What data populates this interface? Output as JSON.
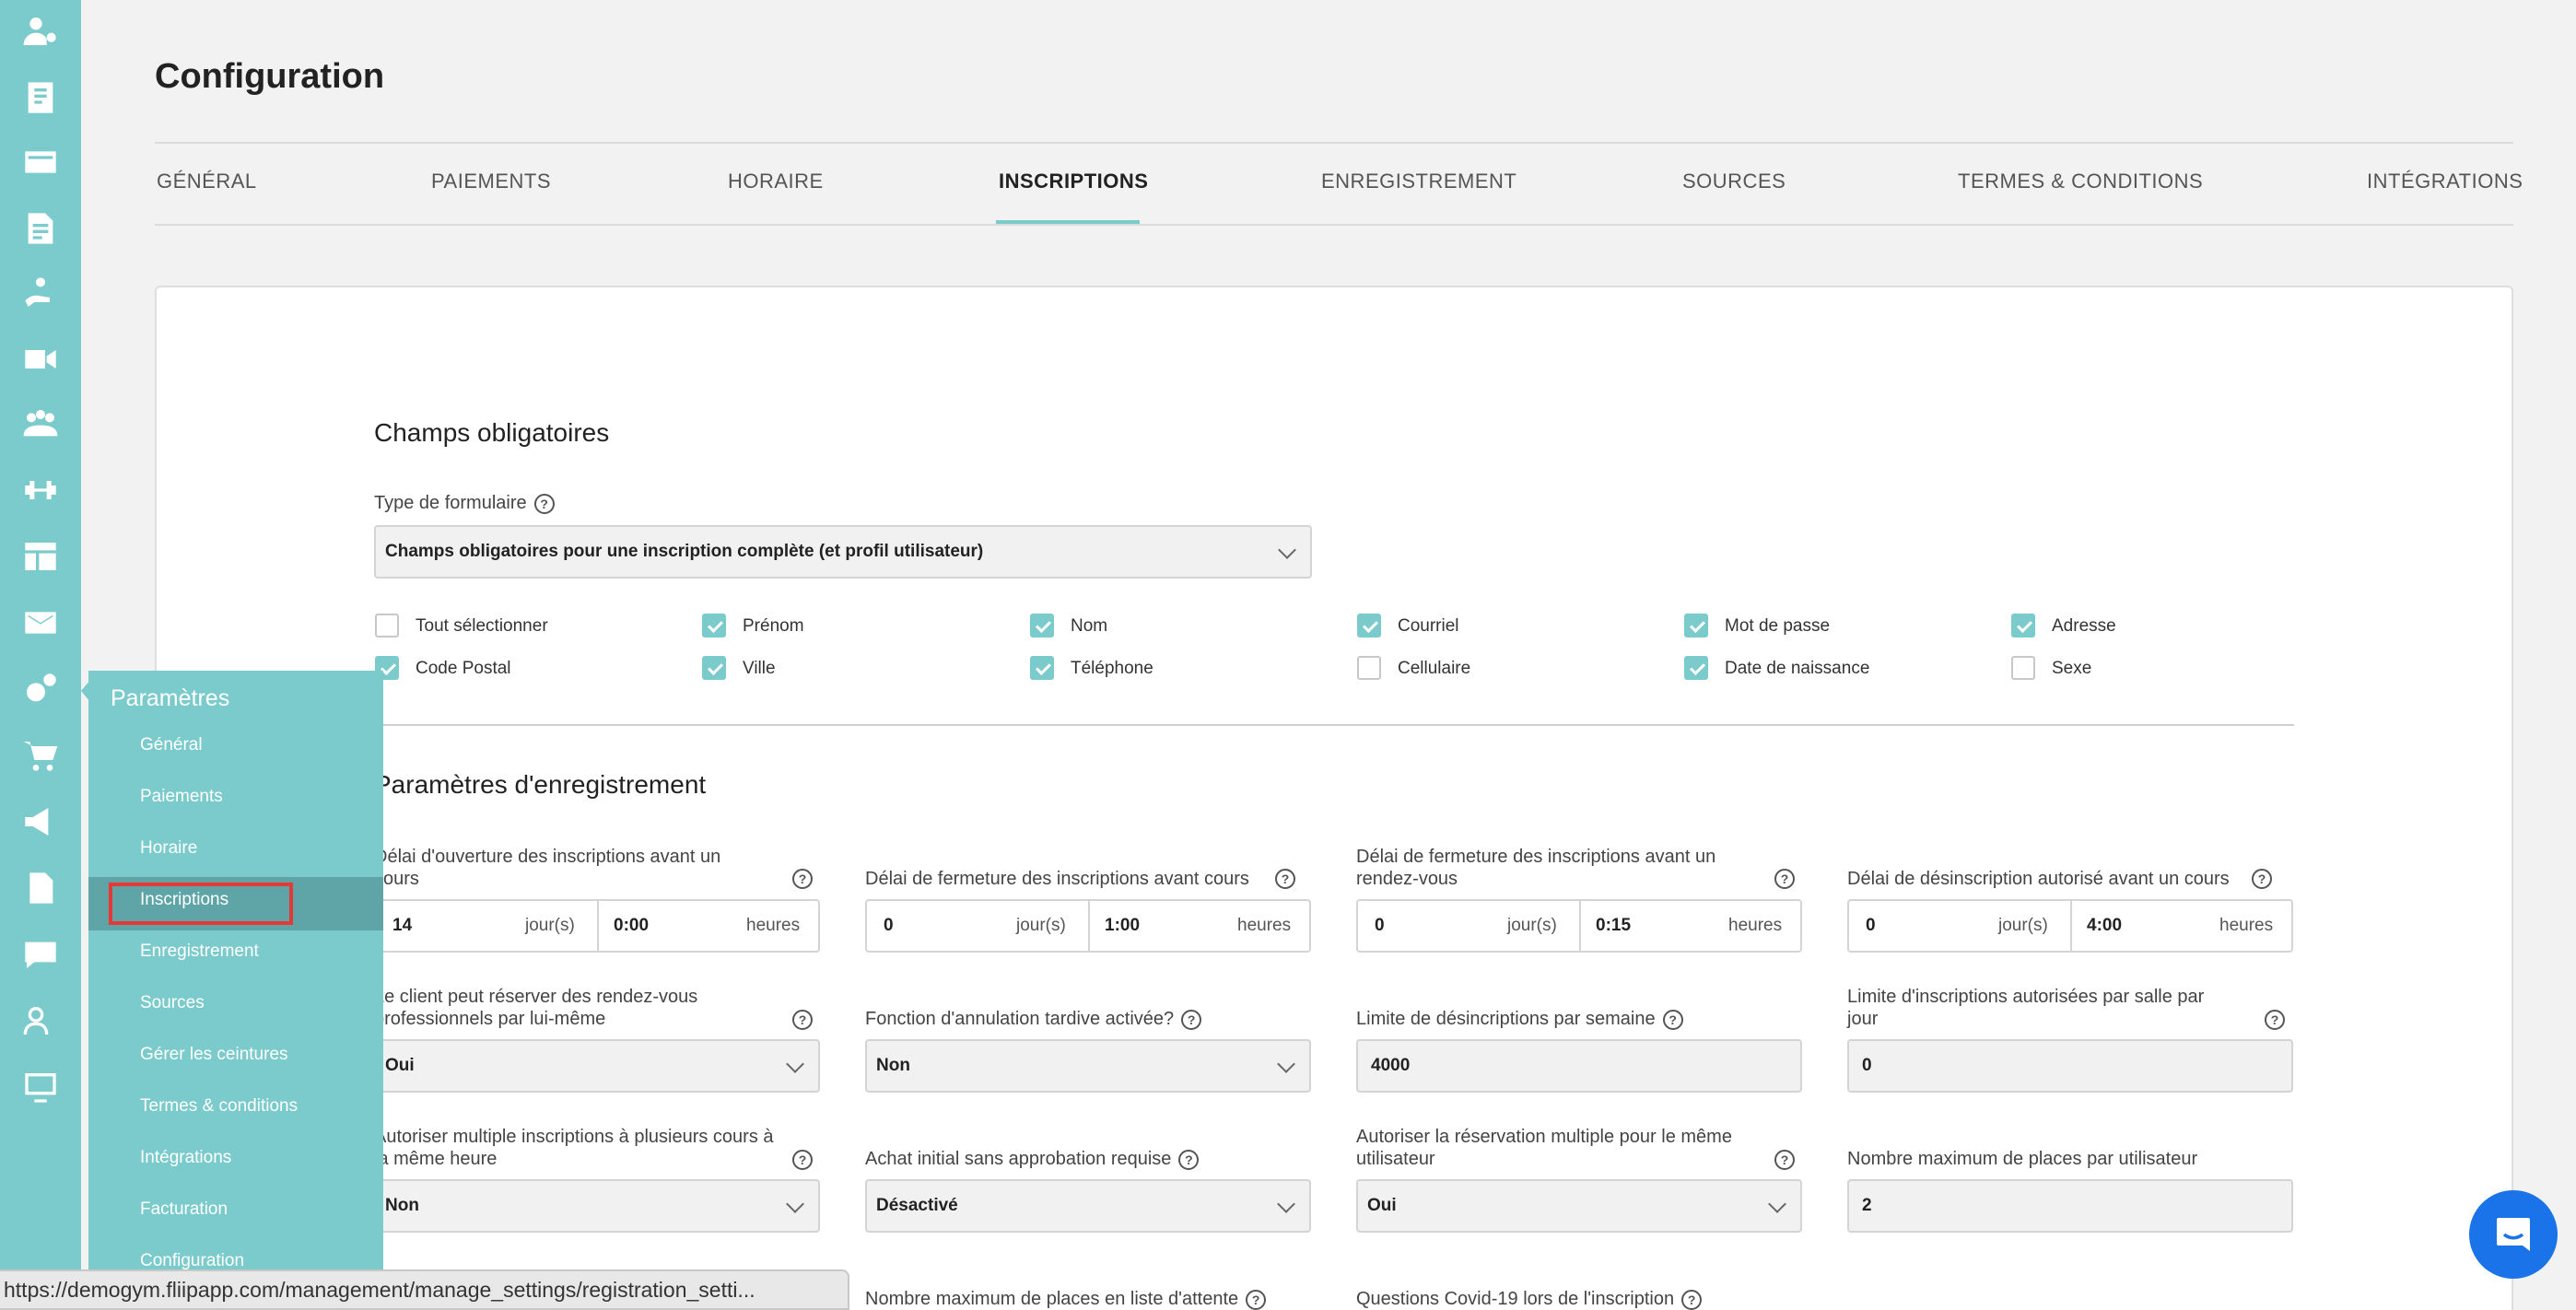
{
  "sidebar_icons": [
    "user-gear-icon",
    "receipt-icon",
    "card-icon",
    "edit-doc-icon",
    "hand-icon",
    "video-icon",
    "group-icon",
    "dumbbell-icon",
    "layout-icon",
    "mail-icon",
    "gears-icon",
    "cart-icon",
    "megaphone-icon",
    "file-icon",
    "chat-icon",
    "users-icon",
    "screen-icon"
  ],
  "header": {
    "title": "Configuration"
  },
  "tabs": [
    {
      "label": "GÉNÉRAL"
    },
    {
      "label": "PAIEMENTS"
    },
    {
      "label": "HORAIRE"
    },
    {
      "label": "INSCRIPTIONS"
    },
    {
      "label": "ENREGISTREMENT"
    },
    {
      "label": "SOURCES"
    },
    {
      "label": "TERMES & CONDITIONS"
    },
    {
      "label": "INTÉGRATIONS"
    }
  ],
  "required_fields": {
    "title": "Champs obligatoires",
    "form_type_label": "Type de formulaire",
    "form_type_value": "Champs obligatoires pour une inscription complète (et profil utilisateur)",
    "checkboxes": [
      {
        "label": "Tout sélectionner",
        "checked": false
      },
      {
        "label": "Prénom",
        "checked": true
      },
      {
        "label": "Nom",
        "checked": true
      },
      {
        "label": "Courriel",
        "checked": true
      },
      {
        "label": "Mot de passe",
        "checked": true
      },
      {
        "label": "Adresse",
        "checked": true
      },
      {
        "label": "Code Postal",
        "checked": true
      },
      {
        "label": "Ville",
        "checked": true
      },
      {
        "label": "Téléphone",
        "checked": true
      },
      {
        "label": "Cellulaire",
        "checked": false
      },
      {
        "label": "Date de naissance",
        "checked": true
      },
      {
        "label": "Sexe",
        "checked": false
      }
    ]
  },
  "registration": {
    "title": "Paramètres d'enregistrement",
    "row1": [
      {
        "label": "Délai d'ouverture des inscriptions avant un cours",
        "days": "14",
        "days_unit": "jour(s)",
        "hours": "0:00",
        "hours_unit": "heures"
      },
      {
        "label": "Délai de fermeture des inscriptions avant cours",
        "days": "0",
        "days_unit": "jour(s)",
        "hours": "1:00",
        "hours_unit": "heures"
      },
      {
        "label": "Délai de fermeture des inscriptions avant un rendez-vous",
        "days": "0",
        "days_unit": "jour(s)",
        "hours": "0:15",
        "hours_unit": "heures"
      },
      {
        "label": "Délai de désinscription autorisé avant un cours",
        "days": "0",
        "days_unit": "jour(s)",
        "hours": "4:00",
        "hours_unit": "heures"
      }
    ],
    "row2": [
      {
        "label": "Le client peut réserver des rendez-vous professionnels par lui-même",
        "value": "Oui"
      },
      {
        "label": "Fonction d'annulation tardive activée?",
        "value": "Non"
      },
      {
        "label": "Limite de désincriptions par semaine",
        "value": "4000"
      },
      {
        "label": "Limite d'inscriptions autorisées par salle par jour",
        "value": "0"
      }
    ],
    "row3": [
      {
        "label": "Autoriser multiple inscriptions à plusieurs cours à la même heure",
        "value": "Non"
      },
      {
        "label": "Achat initial sans approbation requise",
        "value": "Désactivé"
      },
      {
        "label": "Autoriser la réservation multiple pour le même utilisateur",
        "value": "Oui"
      },
      {
        "label": "Nombre maximum de places par utilisateur",
        "value": "2"
      }
    ],
    "row4": [
      {
        "label": "Nombre maximum de places en liste d'attente"
      },
      {
        "label": "Questions Covid-19 lors de l'inscription"
      }
    ]
  },
  "submenu": {
    "title": "Paramètres",
    "items": [
      "Général",
      "Paiements",
      "Horaire",
      "Inscriptions",
      "Enregistrement",
      "Sources",
      "Gérer les ceintures",
      "Termes & conditions",
      "Intégrations",
      "Facturation",
      "Configuration"
    ],
    "active": "Inscriptions"
  },
  "statusbar": {
    "url": "https://demogym.fliipapp.com/management/manage_settings/registration_setti..."
  },
  "colors": {
    "accent": "#7ccbcc",
    "accent_dark": "#5fa5a8",
    "highlight": "#e53935",
    "chat": "#1a73e8"
  }
}
